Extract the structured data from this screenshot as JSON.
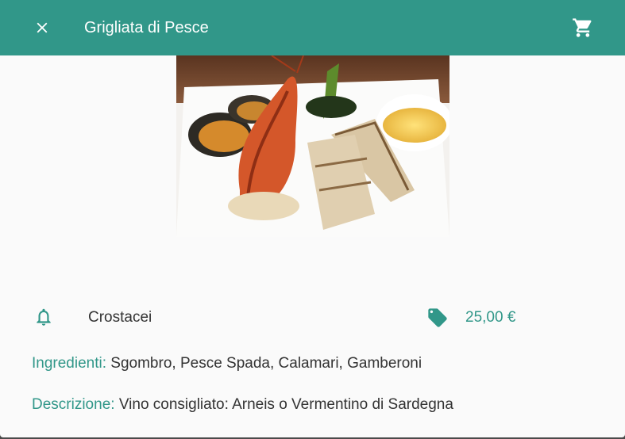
{
  "header": {
    "title": "Grigliata di Pesce",
    "close_icon": "close-icon",
    "cart_icon": "shopping-cart-icon"
  },
  "dish": {
    "image_alt": "grilled seafood plate",
    "category": "Crostacei",
    "price": "25,00 €",
    "ingredients_label": "Ingredienti:",
    "ingredients": "Sgombro, Pesce Spada, Calamari, Gamberoni",
    "description_label": "Descrizione:",
    "description": "Vino consigliato: Arneis o Vermentino di Sardegna"
  },
  "colors": {
    "accent": "#319789",
    "background": "#fafafa"
  }
}
